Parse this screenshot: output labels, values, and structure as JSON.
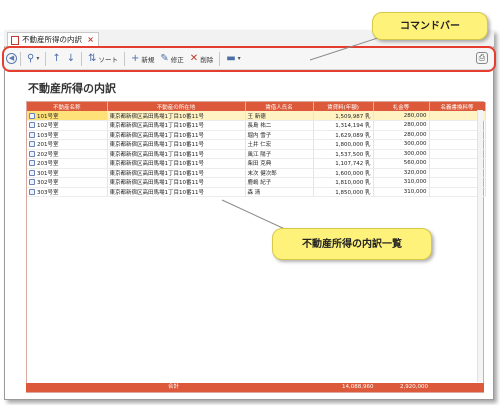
{
  "tab": {
    "label": "不動産所得の内訳",
    "close": "×"
  },
  "toolbar": {
    "sort_label": "ソート",
    "new_label": "新規",
    "edit_label": "修正",
    "delete_label": "削除"
  },
  "page": {
    "title": "不動産所得の内訳"
  },
  "table": {
    "columns": [
      "不動産名称",
      "不動産の所在地",
      "賃借人氏名",
      "賃貸料(年額)",
      "礼金等",
      "名義書換料等"
    ],
    "rows": [
      {
        "name": "101号室",
        "address": "東京都新宿区高田馬場1丁目10番11号",
        "tenant": "王 新德",
        "rent": "1,509,987 乳",
        "key": "280,000",
        "fee": ""
      },
      {
        "name": "102号室",
        "address": "東京都新宿区高田馬場1丁目10番11号",
        "tenant": "長島 祐二",
        "rent": "1,314,194 乳",
        "key": "280,000",
        "fee": ""
      },
      {
        "name": "103号室",
        "address": "東京都新宿区高田馬場1丁目10番11号",
        "tenant": "堀内 雪子",
        "rent": "1,629,089 乳",
        "key": "280,000",
        "fee": ""
      },
      {
        "name": "201号室",
        "address": "東京都新宿区高田馬場1丁目10番11号",
        "tenant": "土井 仁宏",
        "rent": "1,800,000 乳",
        "key": "300,000",
        "fee": ""
      },
      {
        "name": "202号室",
        "address": "東京都新宿区高田馬場1丁目10番11号",
        "tenant": "風江 陽子",
        "rent": "1,537,500 乳",
        "key": "300,000",
        "fee": ""
      },
      {
        "name": "203号室",
        "address": "東京都新宿区高田馬場1丁目10番11号",
        "tenant": "柴田 克典",
        "rent": "1,107,742 乳",
        "key": "560,000",
        "fee": ""
      },
      {
        "name": "301号室",
        "address": "東京都新宿区高田馬場1丁目10番11号",
        "tenant": "末次 健次郎",
        "rent": "1,600,000 乳",
        "key": "320,000",
        "fee": ""
      },
      {
        "name": "302号室",
        "address": "東京都新宿区高田馬場1丁目10番11号",
        "tenant": "鹿嶋 紀子",
        "rent": "1,810,000 乳",
        "key": "310,000",
        "fee": ""
      },
      {
        "name": "303号室",
        "address": "東京都新宿区高田馬場1丁目10番11号",
        "tenant": "森 清",
        "rent": "1,850,000 乳",
        "key": "310,000",
        "fee": ""
      }
    ],
    "total_label": "合計",
    "total_rent": "14,088,960",
    "total_key": "2,920,000"
  },
  "callouts": {
    "command_bar": "コマンドバー",
    "list": "不動産所得の内訳一覧"
  },
  "colors": {
    "header": "#dc5a3b",
    "highlight": "#e53d2f",
    "callout": "#fff27a"
  }
}
